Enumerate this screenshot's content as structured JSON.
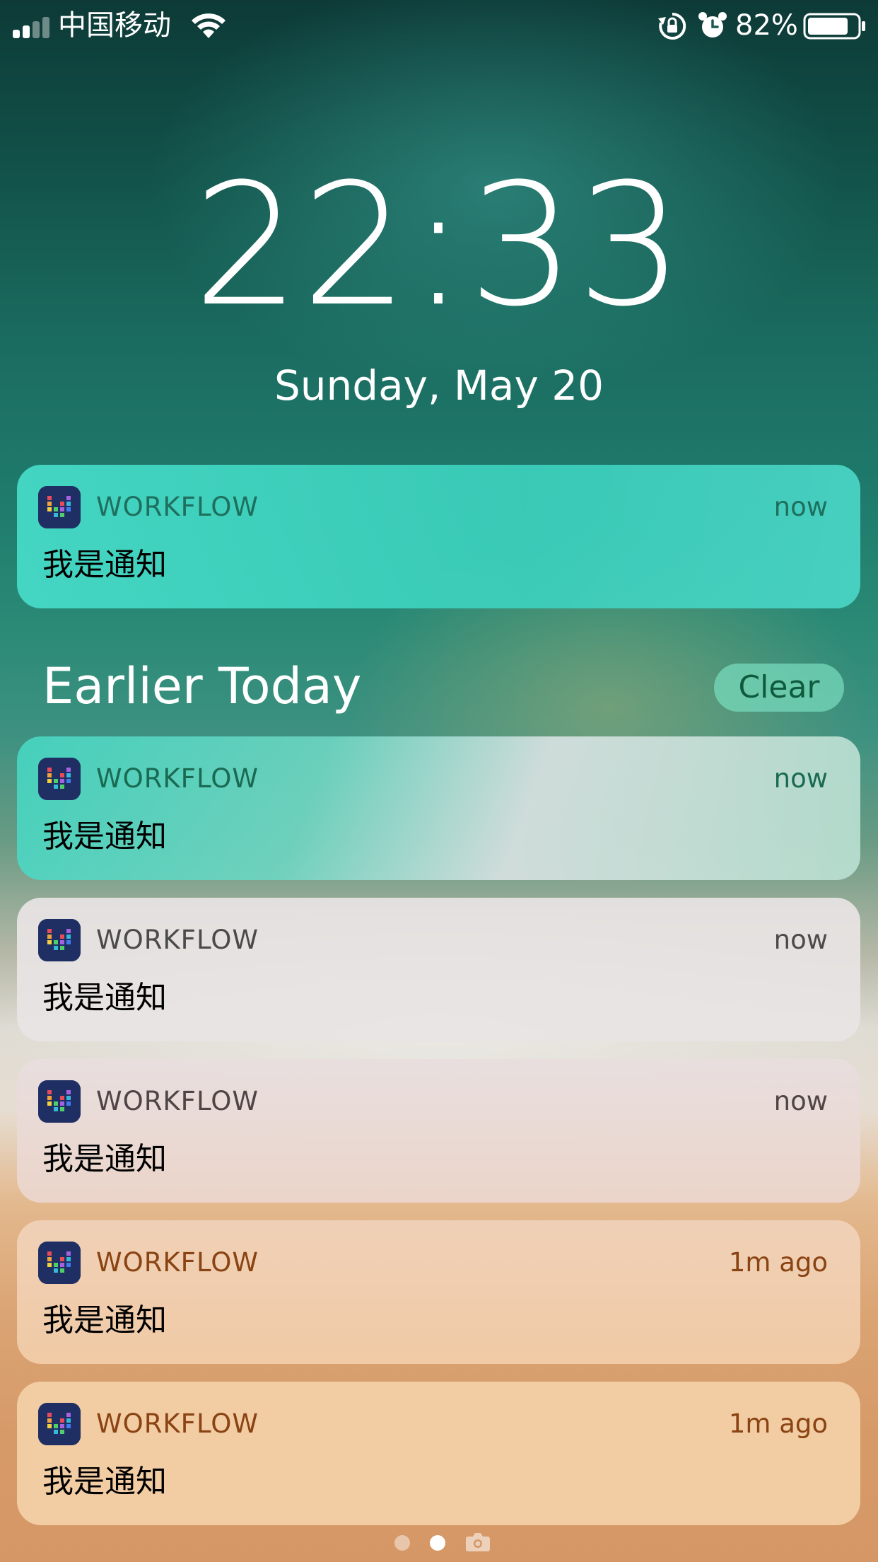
{
  "status_bar": {
    "carrier": "中国移动",
    "battery_percent": "82%",
    "battery_level": 0.82,
    "signal_bars_filled": 2,
    "signal_bars_total": 4,
    "icons": [
      "signal-icon",
      "wifi-icon",
      "rotation-lock-icon",
      "alarm-icon",
      "battery-icon"
    ]
  },
  "lock_screen": {
    "time": "22:33",
    "date": "Sunday, May 20"
  },
  "current_notification": {
    "app": "WORKFLOW",
    "time": "now",
    "body": "我是通知"
  },
  "earlier_today": {
    "title": "Earlier Today",
    "clear_label": "Clear",
    "notifications": [
      {
        "app": "WORKFLOW",
        "time": "now",
        "body": "我是通知"
      },
      {
        "app": "WORKFLOW",
        "time": "now",
        "body": "我是通知"
      },
      {
        "app": "WORKFLOW",
        "time": "now",
        "body": "我是通知"
      },
      {
        "app": "WORKFLOW",
        "time": "1m ago",
        "body": "我是通知"
      },
      {
        "app": "WORKFLOW",
        "time": "1m ago",
        "body": "我是通知"
      }
    ]
  },
  "page_indicator": {
    "pages": 2,
    "current_page": 2,
    "camera": "camera-icon"
  },
  "colors": {
    "text_white": "#ffffff",
    "card_teal": "#3fd6c4",
    "card_grey": "#e6e0e0",
    "card_peach": "#f2c9a0"
  }
}
